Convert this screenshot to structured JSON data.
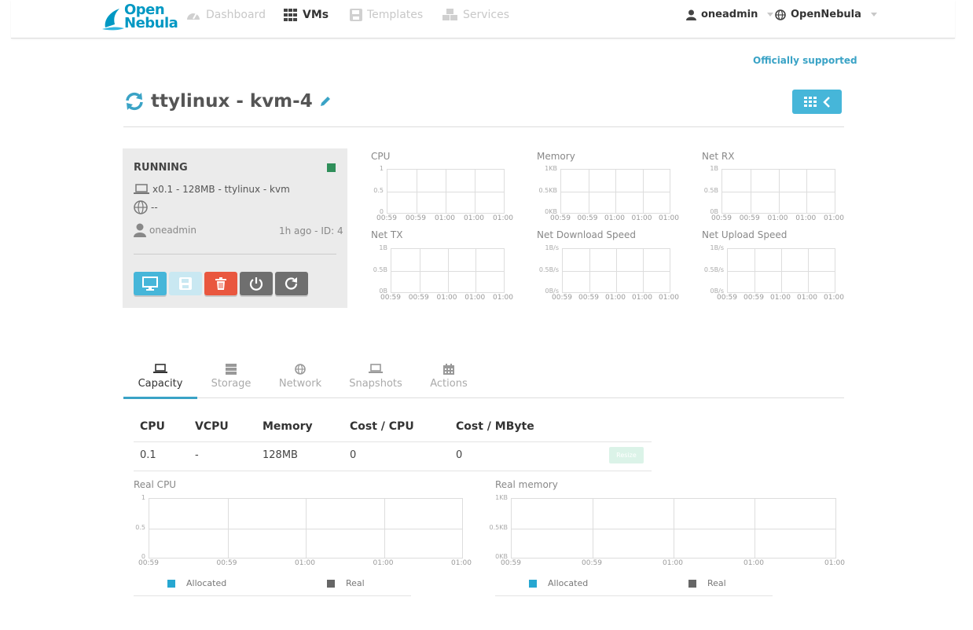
{
  "app": {
    "logo_line1": "Open",
    "logo_line2": "Nebula"
  },
  "nav": {
    "dashboard": "Dashboard",
    "vms": "VMs",
    "templates": "Templates",
    "services": "Services",
    "user": "oneadmin",
    "zone": "OpenNebula"
  },
  "support_label": "Officially supported",
  "vm": {
    "name": "ttylinux - kvm-4",
    "state": "RUNNING",
    "state_color": "#2f8f5a",
    "summary": "x0.1 - 128MB - ttylinux - kvm",
    "ip": "--",
    "owner": "oneadmin",
    "meta": "1h ago - ID: 4"
  },
  "actions": [
    "vnc-button",
    "save-button",
    "delete-button",
    "power-button",
    "reboot-button"
  ],
  "mini_charts": [
    {
      "title": "CPU",
      "y": [
        "1",
        "0.5",
        "0"
      ],
      "x": [
        "00:59",
        "00:59",
        "01:00",
        "01:00",
        "01:00"
      ]
    },
    {
      "title": "Memory",
      "y": [
        "1KB",
        "0.5KB",
        "0KB"
      ],
      "x": [
        "00:59",
        "00:59",
        "01:00",
        "01:00",
        "01:00"
      ]
    },
    {
      "title": "Net RX",
      "y": [
        "1B",
        "0.5B",
        "0B"
      ],
      "x": [
        "00:59",
        "00:59",
        "01:00",
        "01:00",
        "01:00"
      ]
    },
    {
      "title": "Net TX",
      "y": [
        "1B",
        "0.5B",
        "0B"
      ],
      "x": [
        "00:59",
        "00:59",
        "01:00",
        "01:00",
        "01:00"
      ]
    },
    {
      "title": "Net Download Speed",
      "y": [
        "1B/s",
        "0.5B/s",
        "0B/s"
      ],
      "x": [
        "00:59",
        "00:59",
        "01:00",
        "01:00",
        "01:00"
      ]
    },
    {
      "title": "Net Upload Speed",
      "y": [
        "1B/s",
        "0.5B/s",
        "0B/s"
      ],
      "x": [
        "00:59",
        "00:59",
        "01:00",
        "01:00",
        "01:00"
      ]
    }
  ],
  "tabs": [
    "Capacity",
    "Storage",
    "Network",
    "Snapshots",
    "Actions"
  ],
  "capacity": {
    "headers": [
      "CPU",
      "VCPU",
      "Memory",
      "Cost / CPU",
      "Cost / MByte"
    ],
    "row": [
      "0.1",
      "-",
      "128MB",
      "0",
      "0"
    ],
    "resize_label": "Resize"
  },
  "real_charts": [
    {
      "title": "Real CPU",
      "y": [
        "1",
        "0.5",
        "0"
      ],
      "x": [
        "00:59",
        "00:59",
        "01:00",
        "01:00",
        "01:00"
      ]
    },
    {
      "title": "Real memory",
      "y": [
        "1KB",
        "0.5KB",
        "0KB"
      ],
      "x": [
        "00:59",
        "00:59",
        "01:00",
        "01:00",
        "01:00"
      ]
    }
  ],
  "legend": {
    "allocated": "Allocated",
    "real": "Real",
    "allocated_color": "#27a7d1",
    "real_color": "#666666"
  }
}
